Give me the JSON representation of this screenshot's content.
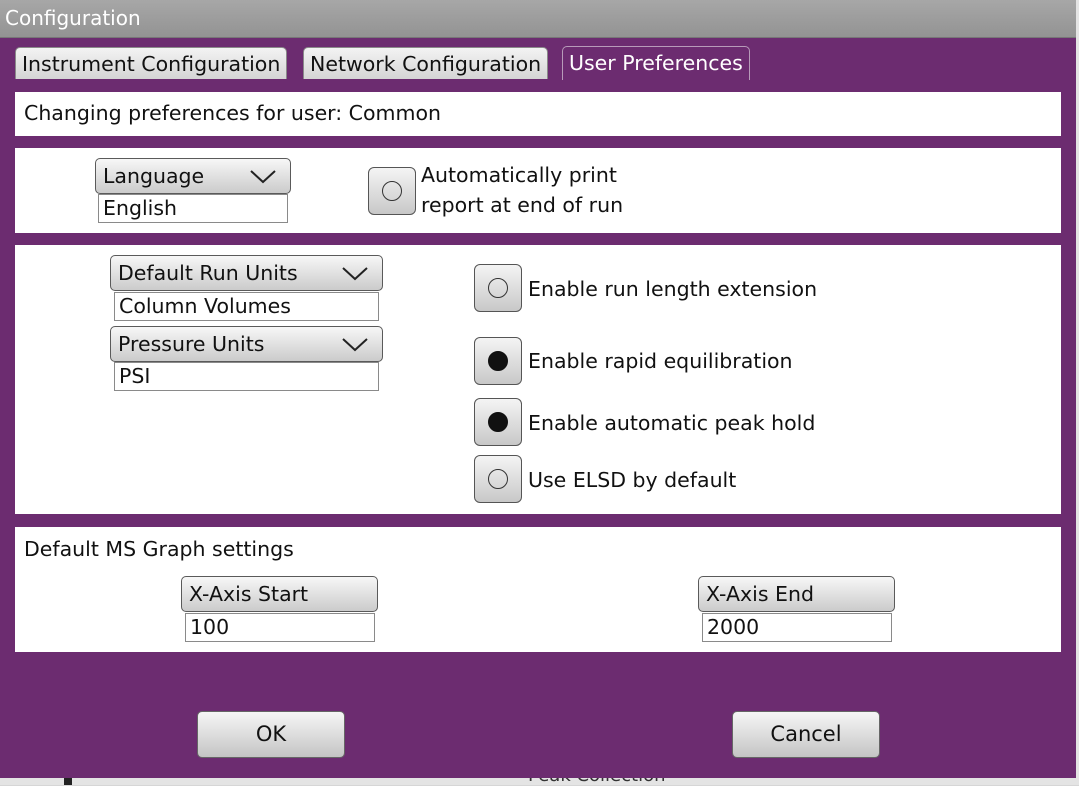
{
  "background": {
    "underlying_text": "Peak Collection"
  },
  "window": {
    "title": "Configuration",
    "accent": "#6c2c70"
  },
  "tabs": [
    {
      "label": "Instrument Configuration",
      "active": false
    },
    {
      "label": "Network Configuration",
      "active": false
    },
    {
      "label": "User Preferences",
      "active": true
    }
  ],
  "user_header": {
    "text": "Changing preferences for user: Common"
  },
  "language": {
    "label": "Language",
    "value": "English"
  },
  "auto_print": {
    "line1": "Automatically print",
    "line2": "report at end of run",
    "checked": false
  },
  "run_units": {
    "label": "Default Run Units",
    "value": "Column Volumes"
  },
  "pressure_units": {
    "label": "Pressure Units",
    "value": "PSI"
  },
  "options": [
    {
      "label": "Enable run length extension",
      "checked": false
    },
    {
      "label": "Enable rapid equilibration",
      "checked": true
    },
    {
      "label": "Enable automatic peak hold",
      "checked": true
    },
    {
      "label": "Use ELSD by default",
      "checked": false
    }
  ],
  "ms_graph": {
    "title": "Default MS Graph settings",
    "x_start": {
      "label": "X-Axis Start",
      "value": "100"
    },
    "x_end": {
      "label": "X-Axis End",
      "value": "2000"
    }
  },
  "buttons": {
    "ok": "OK",
    "cancel": "Cancel"
  }
}
